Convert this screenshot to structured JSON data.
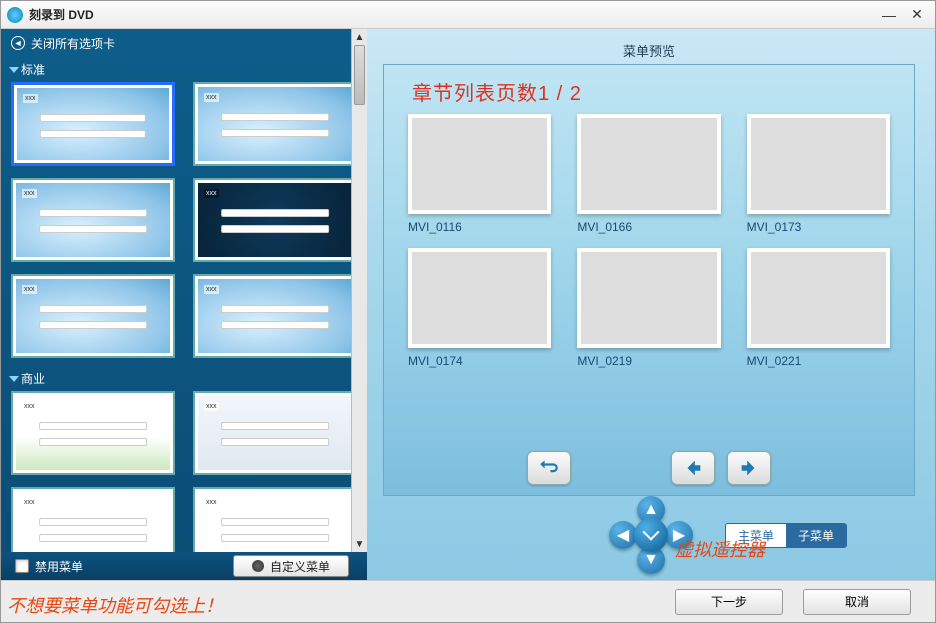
{
  "window": {
    "title": "刻录到 DVD"
  },
  "left": {
    "close_all": "关闭所有选项卡",
    "sections": {
      "standard": "标准",
      "business": "商业"
    },
    "disable_menu_label": "禁用菜单",
    "custom_menu_label": "自定义菜单"
  },
  "preview": {
    "title": "菜单预览",
    "chapter_label": "章节列表页数",
    "page_current": "1",
    "page_sep": " / ",
    "page_total": "2",
    "clips": [
      {
        "name": "MVI_0116"
      },
      {
        "name": "MVI_0166"
      },
      {
        "name": "MVI_0173"
      },
      {
        "name": "MVI_0174"
      },
      {
        "name": "MVI_0219"
      },
      {
        "name": "MVI_0221"
      }
    ],
    "menu_main": "主菜单",
    "menu_sub": "子菜单"
  },
  "annotations": {
    "virtual_controller": "虚拟遥控器",
    "disable_hint": "不想要菜单功能可勾选上！"
  },
  "footer": {
    "next": "下一步",
    "cancel": "取消"
  }
}
